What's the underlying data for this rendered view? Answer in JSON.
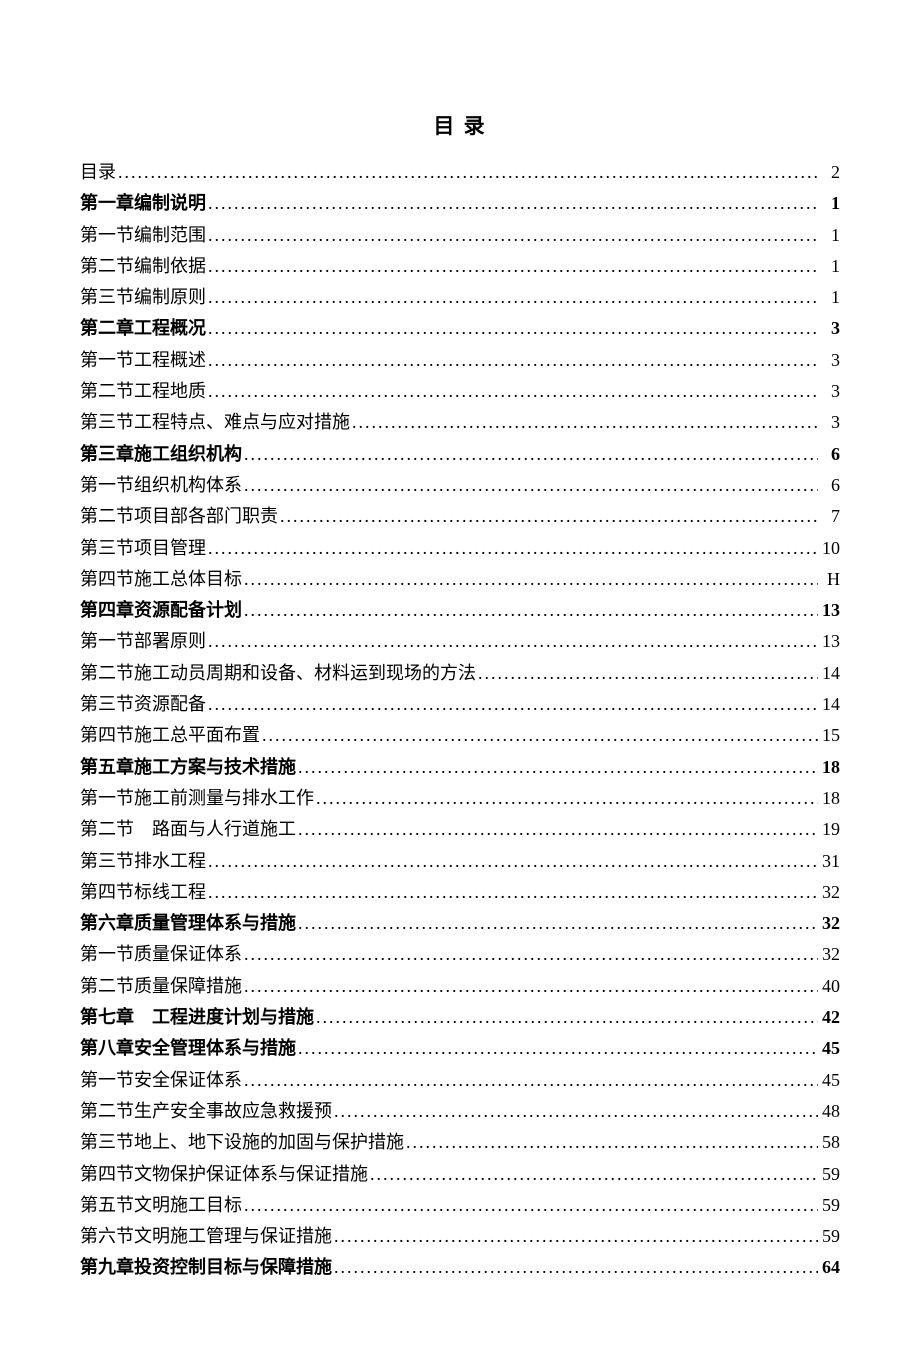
{
  "title": "目 录",
  "toc": [
    {
      "label": "目录",
      "page": "2",
      "bold": false
    },
    {
      "label": "第一章编制说明",
      "page": "1",
      "bold": true
    },
    {
      "label": "第一节编制范围",
      "page": "1",
      "bold": false
    },
    {
      "label": "第二节编制依据",
      "page": "1",
      "bold": false
    },
    {
      "label": "第三节编制原则",
      "page": "1",
      "bold": false
    },
    {
      "label": "第二章工程概况",
      "page": "3",
      "bold": true
    },
    {
      "label": "第一节工程概述",
      "page": "3",
      "bold": false
    },
    {
      "label": "第二节工程地质",
      "page": "3",
      "bold": false
    },
    {
      "label": "第三节工程特点、难点与应对措施",
      "page": "3",
      "bold": false
    },
    {
      "label": "第三章施工组织机构",
      "page": "6",
      "bold": true
    },
    {
      "label": "第一节组织机构体系",
      "page": "6",
      "bold": false
    },
    {
      "label": "第二节项目部各部门职责",
      "page": "7",
      "bold": false
    },
    {
      "label": "第三节项目管理",
      "page": "10",
      "bold": false
    },
    {
      "label": "第四节施工总体目标",
      "page": "H",
      "bold": false
    },
    {
      "label": "第四章资源配备计划",
      "page": "13",
      "bold": true
    },
    {
      "label": "第一节部署原则",
      "page": "13",
      "bold": false
    },
    {
      "label": "第二节施工动员周期和设备、材料运到现场的方法",
      "page": "14",
      "bold": false
    },
    {
      "label": "第三节资源配备",
      "page": "14",
      "bold": false
    },
    {
      "label": "第四节施工总平面布置",
      "page": "15",
      "bold": false
    },
    {
      "label": "第五章施工方案与技术措施",
      "page": "18",
      "bold": true
    },
    {
      "label": "第一节施工前测量与排水工作",
      "page": "18",
      "bold": false
    },
    {
      "label": "第二节　路面与人行道施工",
      "page": "19",
      "bold": false
    },
    {
      "label": "第三节排水工程",
      "page": "31",
      "bold": false
    },
    {
      "label": "第四节标线工程",
      "page": "32",
      "bold": false
    },
    {
      "label": "第六章质量管理体系与措施",
      "page": "32",
      "bold": true
    },
    {
      "label": "第一节质量保证体系",
      "page": "32",
      "bold": false
    },
    {
      "label": "第二节质量保障措施",
      "page": "40",
      "bold": false
    },
    {
      "label": "第七章　工程进度计划与措施",
      "page": "42",
      "bold": true
    },
    {
      "label": "第八章安全管理体系与措施",
      "page": "45",
      "bold": true
    },
    {
      "label": "第一节安全保证体系",
      "page": "45",
      "bold": false
    },
    {
      "label": "第二节生产安全事故应急救援预",
      "page": "48",
      "bold": false
    },
    {
      "label": "第三节地上、地下设施的加固与保护措施",
      "page": "58",
      "bold": false
    },
    {
      "label": "第四节文物保护保证体系与保证措施",
      "page": "59",
      "bold": false
    },
    {
      "label": "第五节文明施工目标",
      "page": "59",
      "bold": false
    },
    {
      "label": "第六节文明施工管理与保证措施",
      "page": "59",
      "bold": false
    },
    {
      "label": "第九章投资控制目标与保障措施",
      "page": "64",
      "bold": true
    }
  ]
}
